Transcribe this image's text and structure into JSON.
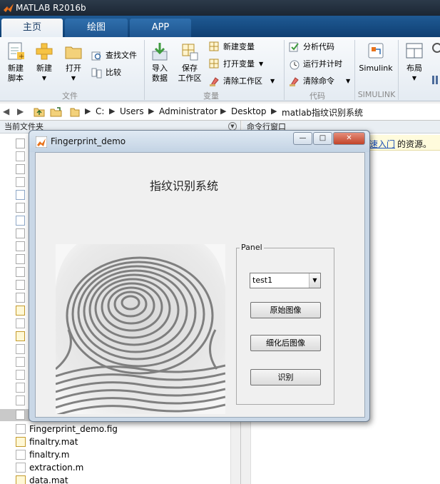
{
  "app": {
    "title": "MATLAB R2016b"
  },
  "tabs": [
    {
      "label": "主页",
      "active": true
    },
    {
      "label": "绘图",
      "active": false
    },
    {
      "label": "APP",
      "active": false
    }
  ],
  "ribbon": {
    "new_script": "新建\n脚本",
    "new": "新建",
    "open": "打开",
    "find_files": "查找文件",
    "compare": "比较",
    "import_data": "导入\n数据",
    "save_workspace": "保存\n工作区",
    "new_variable": "新建变量",
    "open_variable": "打开变量",
    "clear_workspace": "清除工作区",
    "analyze_code": "分析代码",
    "run_and_time": "运行并计时",
    "clear_commands": "清除命令",
    "simulink": "Simulink",
    "layout": "布局",
    "groups": [
      "文件",
      "变量",
      "代码",
      "SIMULINK"
    ]
  },
  "address_bar": {
    "path": [
      "C:",
      "Users",
      "Administrator",
      "Desktop",
      "matlab指纹识别系统"
    ]
  },
  "current_folder": {
    "header": "当前文件夹",
    "files": [
      {
        "name": "Fingerprint_demo.fig",
        "type": "fig"
      },
      {
        "name": "finaltry.mat",
        "type": "mat"
      },
      {
        "name": "finaltry.m",
        "type": "m"
      },
      {
        "name": "extraction.m",
        "type": "m"
      },
      {
        "name": "data.mat",
        "type": "mat"
      }
    ]
  },
  "command_window": {
    "header": "命令行窗口",
    "notice_link": "速入门",
    "notice_tail": "的资源。"
  },
  "figure": {
    "title": "Fingerprint_demo",
    "heading": "指纹识别系统",
    "panel_title": "Panel",
    "popup_value": "test1",
    "btn_original": "原始图像",
    "btn_thinned": "细化后图像",
    "btn_recognize": "识别"
  },
  "colors": {
    "titlebar": "#1b2633",
    "tab_strip": "#1f5a94",
    "ribbon": "#eef2f6",
    "figure_bg": "#f0f0f0"
  }
}
